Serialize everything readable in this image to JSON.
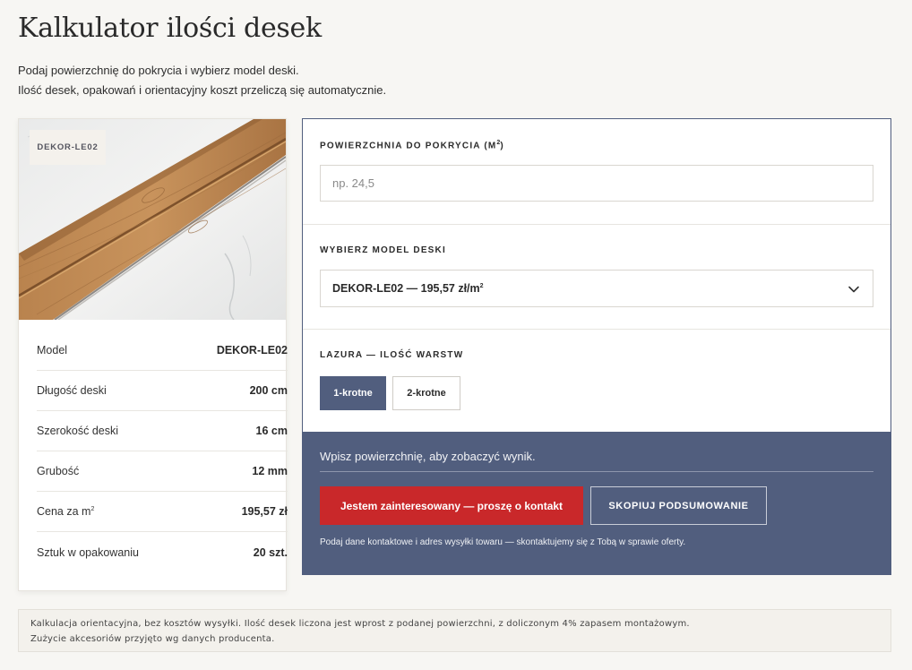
{
  "page": {
    "title": "Kalkulator ilości desek",
    "intro_line1": "Podaj powierzchnię do pokrycia i wybierz model deski.",
    "intro_line2": "Ilość desek, opakowań i orientacyjny koszt przeliczą się automatycznie."
  },
  "product": {
    "badge": "DEKOR-LE02",
    "specs": [
      {
        "label": "Model",
        "value": "DEKOR-LE02"
      },
      {
        "label": "Długość deski",
        "value": "200 cm"
      },
      {
        "label": "Szerokość deski",
        "value": "16 cm"
      },
      {
        "label": "Grubość",
        "value": "12 mm"
      },
      {
        "label": "Cena za m",
        "label_sup": "2",
        "value": "195,57 zł"
      },
      {
        "label": "Sztuk w opakowaniu",
        "value": "20 szt."
      }
    ]
  },
  "calculator": {
    "area_label": "POWIERZCHNIA DO POKRYCIA (M",
    "area_label_sup": "2",
    "area_label_end": ")",
    "area_placeholder": "np. 24,5",
    "area_value": "",
    "model_label": "WYBIERZ MODEL DESKI",
    "model_selected": "DEKOR-LE02 — 195,57 zł/m",
    "model_selected_sup": "2",
    "stain_label": "LAZURA — ILOŚĆ WARSTW",
    "stain_options": [
      {
        "label": "1-krotne",
        "active": true
      },
      {
        "label": "2-krotne",
        "active": false
      }
    ]
  },
  "result": {
    "message": "Wpisz powierzchnię, aby zobaczyć wynik.",
    "contact_button": "Jestem zainteresowany — proszę o kontakt",
    "copy_button": "SKOPIUJ PODSUMOWANIE",
    "note": "Podaj dane kontaktowe i adres wysyłki towaru — skontaktujemy się z Tobą w sprawie oferty."
  },
  "footnote": {
    "line1": "Kalkulacja orientacyjna, bez kosztów wysyłki. Ilość desek liczona jest wprost z podanej powierzchni, z doliczonym 4% zapasem montażowym.",
    "line2": "Zużycie akcesoriów przyjęto wg danych producenta."
  },
  "colors": {
    "accent": "#515e7e",
    "contact_red": "#c9282a",
    "background": "#f7f6f3"
  },
  "icons": {
    "select_arrow": "chevron-down-icon"
  }
}
